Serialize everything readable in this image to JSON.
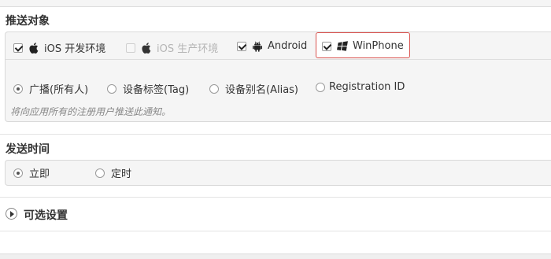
{
  "target_section": {
    "title": "推送对象",
    "platforms": [
      {
        "label": "iOS 开发环境",
        "checked": true,
        "disabled": false,
        "icon": "apple-icon"
      },
      {
        "label": "iOS 生产环境",
        "checked": false,
        "disabled": true,
        "icon": "apple-icon"
      },
      {
        "label": "Android",
        "checked": true,
        "disabled": false,
        "icon": "android-icon"
      },
      {
        "label": "WinPhone",
        "checked": true,
        "disabled": false,
        "icon": "windows-icon"
      }
    ],
    "audience_options": [
      {
        "label": "广播(所有人)",
        "selected": true
      },
      {
        "label": "设备标签(Tag)",
        "selected": false
      },
      {
        "label": "设备别名(Alias)",
        "selected": false
      },
      {
        "label": "Registration ID",
        "selected": false
      }
    ],
    "note": "将向应用所有的注册用户推送此通知。"
  },
  "time_section": {
    "title": "发送时间",
    "options": [
      {
        "label": "立即",
        "selected": true
      },
      {
        "label": "定时",
        "selected": false
      }
    ]
  },
  "optional_section": {
    "title": "可选设置"
  },
  "colors": {
    "highlight_border": "#d9534f",
    "panel_bg": "#f5f5f5"
  }
}
